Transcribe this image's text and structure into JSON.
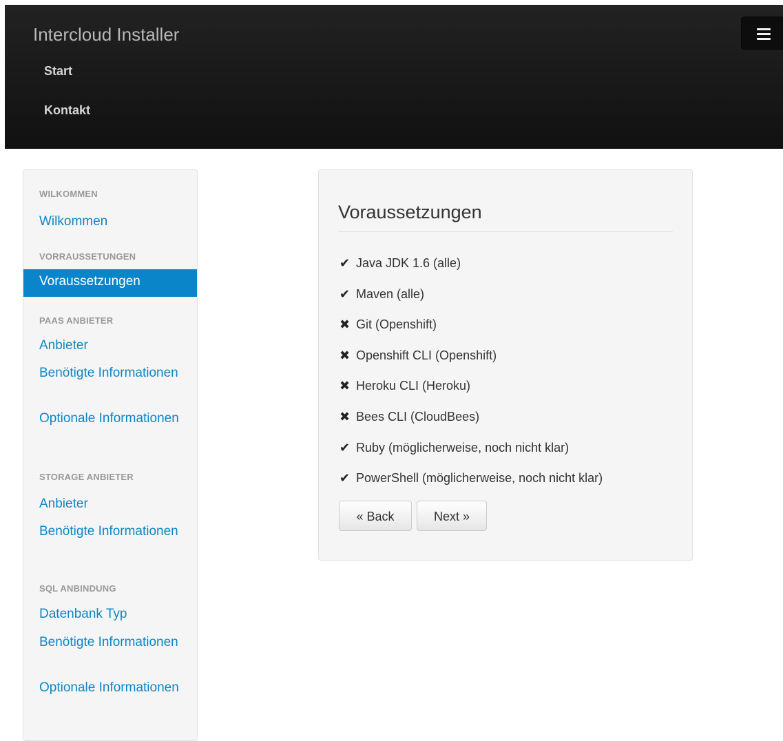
{
  "navbar": {
    "brand": "Intercloud Installer",
    "links": [
      {
        "label": "Start"
      },
      {
        "label": "Kontakt"
      }
    ],
    "menu_icon": "hamburger-menu-icon"
  },
  "sidebar": {
    "sections": [
      {
        "header": "WILKOMMEN",
        "items": [
          "Wilkommen"
        ]
      },
      {
        "header": "VORRAUSSETUNGEN",
        "items": [
          "Voraussetzungen"
        ]
      },
      {
        "header": "PAAS ANBIETER",
        "items": [
          "Anbieter",
          "Benötigte Informationen",
          "Optionale Informationen"
        ]
      },
      {
        "header": "STORAGE ANBIETER",
        "items": [
          "Anbieter",
          "Benötigte Informationen"
        ]
      },
      {
        "header": "SQL ANBINDUNG",
        "items": [
          "Datenbank Typ",
          "Benötigte Informationen",
          "Optionale Informationen"
        ]
      }
    ],
    "active_item": "Voraussetzungen",
    "colors": {
      "active_bg": "#0b85c9",
      "link": "#0d86c6"
    }
  },
  "main": {
    "title": "Voraussetzungen",
    "requirements": [
      {
        "status": "ok",
        "icon": "check-icon",
        "glyph": "✔",
        "label": "Java JDK 1.6 (alle)"
      },
      {
        "status": "ok",
        "icon": "check-icon",
        "glyph": "✔",
        "label": "Maven (alle)"
      },
      {
        "status": "missing",
        "icon": "cross-icon",
        "glyph": "✖",
        "label": "Git (Openshift)"
      },
      {
        "status": "missing",
        "icon": "cross-icon",
        "glyph": "✖",
        "label": "Openshift CLI (Openshift)"
      },
      {
        "status": "missing",
        "icon": "cross-icon",
        "glyph": "✖",
        "label": "Heroku CLI (Heroku)"
      },
      {
        "status": "missing",
        "icon": "cross-icon",
        "glyph": "✖",
        "label": "Bees CLI (CloudBees)"
      },
      {
        "status": "ok",
        "icon": "check-icon",
        "glyph": "✔",
        "label": "Ruby (möglicherweise, noch nicht klar)"
      },
      {
        "status": "ok",
        "icon": "check-icon",
        "glyph": "✔",
        "label": "PowerShell (möglicherweise, noch nicht klar)"
      }
    ],
    "back_label": "« Back",
    "next_label": "Next »"
  }
}
